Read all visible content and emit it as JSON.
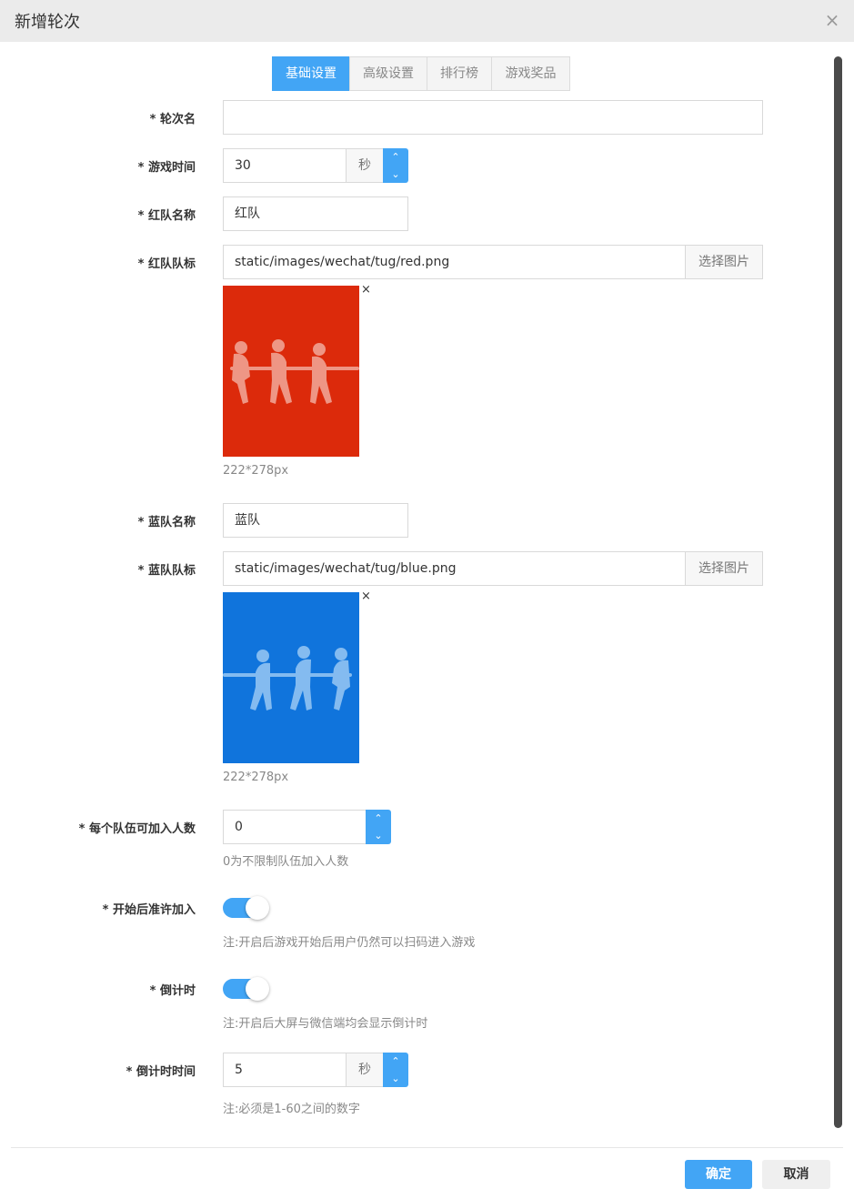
{
  "dialog": {
    "title": "新增轮次"
  },
  "tabs": [
    {
      "label": "基础设置",
      "active": true
    },
    {
      "label": "高级设置",
      "active": false
    },
    {
      "label": "排行榜",
      "active": false
    },
    {
      "label": "游戏奖品",
      "active": false
    }
  ],
  "form": {
    "round_name": {
      "label": "* 轮次名",
      "value": ""
    },
    "game_time": {
      "label": "* 游戏时间",
      "value": "30",
      "unit": "秒"
    },
    "red_name": {
      "label": "* 红队名称",
      "value": "红队"
    },
    "red_logo": {
      "label": "* 红队队标",
      "value": "static/images/wechat/tug/red.png",
      "button": "选择图片",
      "size_hint": "222*278px",
      "remove": "×",
      "color": "#dc2a0b"
    },
    "blue_name": {
      "label": "* 蓝队名称",
      "value": "蓝队"
    },
    "blue_logo": {
      "label": "* 蓝队队标",
      "value": "static/images/wechat/tug/blue.png",
      "button": "选择图片",
      "size_hint": "222*278px",
      "remove": "×",
      "color": "#1074dc"
    },
    "team_size": {
      "label": "* 每个队伍可加入人数",
      "value": "0",
      "note": "0为不限制队伍加入人数"
    },
    "allow_join": {
      "label": "* 开始后准许加入",
      "on": true,
      "note": "注:开启后游戏开始后用户仍然可以扫码进入游戏"
    },
    "countdown": {
      "label": "* 倒计时",
      "on": true,
      "note": "注:开启后大屏与微信端均会显示倒计时"
    },
    "countdown_time": {
      "label": "* 倒计时时间",
      "value": "5",
      "unit": "秒",
      "note": "注:必须是1-60之间的数字"
    }
  },
  "footer": {
    "confirm": "确定",
    "cancel": "取消"
  },
  "icons": {
    "close": "close-icon",
    "spin_up": "chevron-up-icon",
    "spin_down": "chevron-down-icon"
  },
  "colors": {
    "accent": "#42a5f5"
  }
}
